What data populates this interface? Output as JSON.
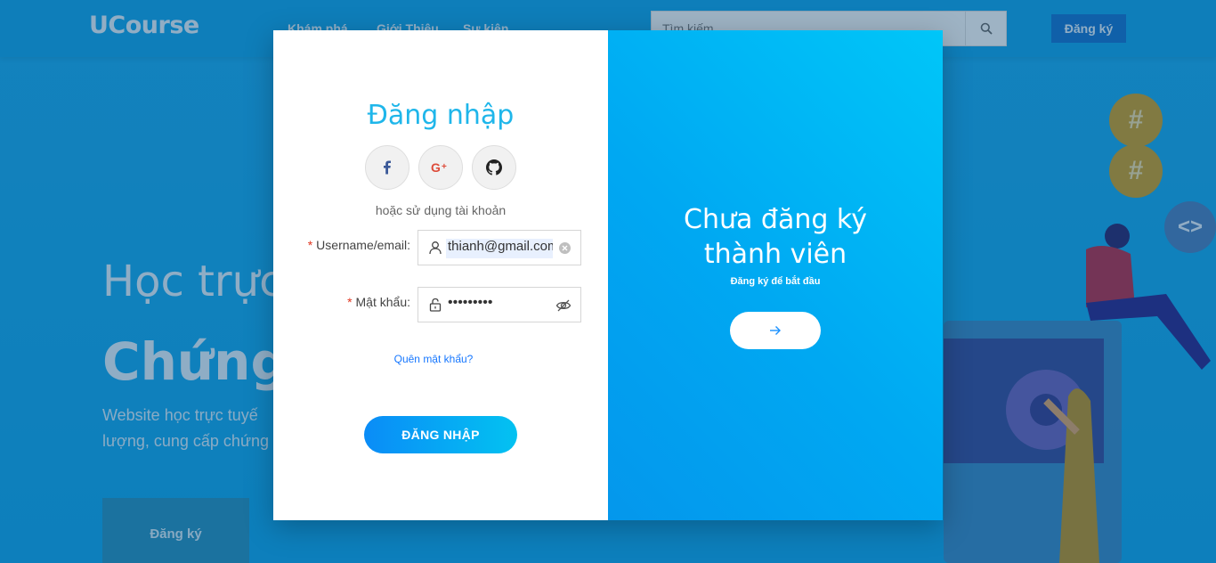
{
  "navbar": {
    "logo": "UCourse",
    "links": [
      "Khám phá",
      "Giới Thiệu",
      "Sự kiện"
    ],
    "search_placeholder": "Tìm kiếm",
    "register_label": "Đăng ký"
  },
  "hero": {
    "line1": "Học trực",
    "line2": "Chứng",
    "desc_line1": "Website học trực tuyế",
    "desc_line2": "lượng, cung cấp chứng",
    "cta_label": "Đăng ký"
  },
  "deco": {
    "hash_symbol": "#",
    "code_symbol": "<>"
  },
  "login": {
    "title": "Đăng nhập",
    "social": [
      "facebook-icon",
      "google-plus-icon",
      "github-icon"
    ],
    "or_text": "hoặc sử dụng tài khoản",
    "username_label": "Username/email",
    "username_value": "thianh@gmail.com",
    "password_label": "Mật khẩu",
    "password_value": "•••••••••",
    "required_mark": "*",
    "colon": ":",
    "forgot_label": "Quên mật khẩu?",
    "submit_label": "ĐĂNG NHẬP"
  },
  "signup": {
    "title_line1": "Chưa đăng ký",
    "title_line2": "thành viên",
    "subtitle": "Đăng ký để bắt đầu",
    "arrow_icon": "arrow-right-icon"
  },
  "colors": {
    "accent": "#1fb6ea",
    "panel_gradient_start": "#00c6f8",
    "panel_gradient_end": "#0497ec",
    "required": "#e0341f",
    "link": "#1677ff"
  }
}
